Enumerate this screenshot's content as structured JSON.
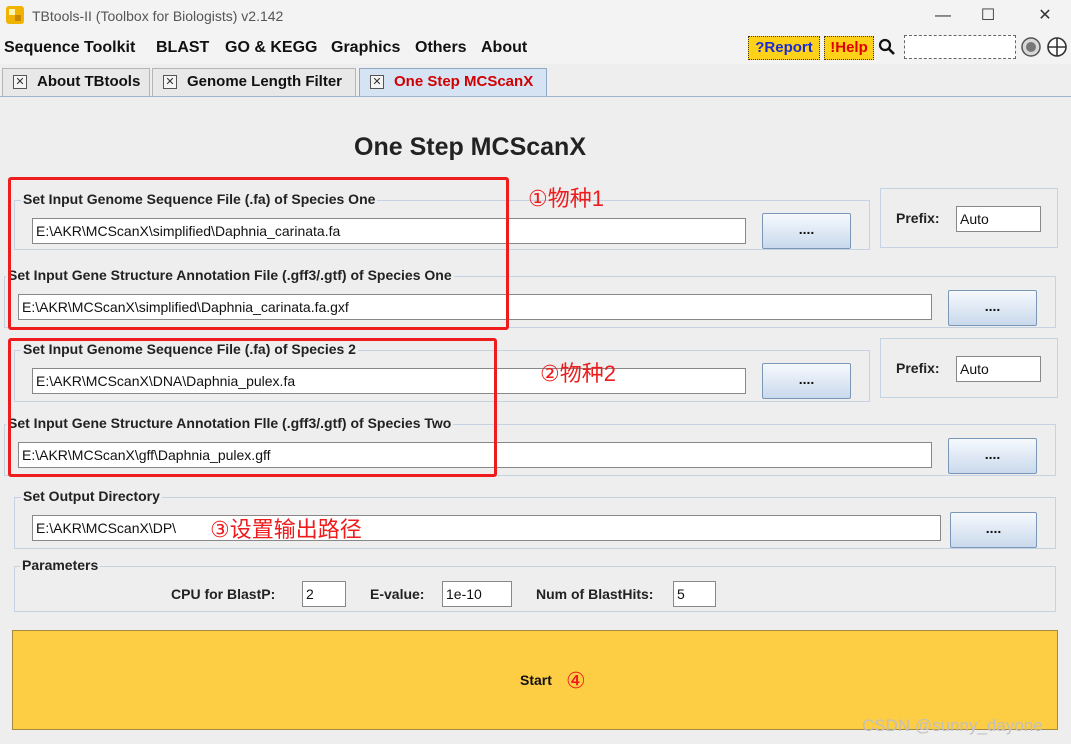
{
  "window": {
    "title": "TBtools-II (Toolbox for Biologists) v2.142",
    "minimize": "—",
    "maximize": "☐",
    "close": "✕"
  },
  "menu": {
    "items": [
      "Sequence Toolkit",
      "BLAST",
      "GO & KEGG",
      "Graphics",
      "Others",
      "About"
    ],
    "report": "?Report",
    "help": "!Help"
  },
  "tabs": [
    {
      "label": "About TBtools"
    },
    {
      "label": "Genome Length Filter"
    },
    {
      "label": "One Step MCScanX"
    }
  ],
  "page_title": "One Step MCScanX",
  "species_one": {
    "genome_label": "Set Input Genome Sequence File (.fa) of Species One",
    "genome_value": "E:\\AKR\\MCScanX\\simplified\\Daphnia_carinata.fa",
    "annotation_label": "Set Input Gene Structure Annotation File (.gff3/.gtf) of Species One",
    "annotation_value": "E:\\AKR\\MCScanX\\simplified\\Daphnia_carinata.fa.gxf",
    "prefix_label": "Prefix:",
    "prefix_value": "Auto"
  },
  "species_two": {
    "genome_label": "Set Input Genome Sequence File (.fa) of Species 2",
    "genome_value": "E:\\AKR\\MCScanX\\DNA\\Daphnia_pulex.fa",
    "annotation_label": "Set Input Gene Structure Annotation Flle (.gff3/.gtf) of Species Two",
    "annotation_value": "E:\\AKR\\MCScanX\\gff\\Daphnia_pulex.gff",
    "prefix_label": "Prefix:",
    "prefix_value": "Auto"
  },
  "output": {
    "label": "Set Output Directory",
    "value": "E:\\AKR\\MCScanX\\DP\\"
  },
  "browse_label": "....",
  "parameters": {
    "label": "Parameters",
    "cpu_label": "CPU for BlastP:",
    "cpu_value": "2",
    "evalue_label": "E-value:",
    "evalue_value": "1e-10",
    "hits_label": "Num of BlastHits:",
    "hits_value": "5"
  },
  "start_label": "Start",
  "annotations": {
    "a1": "①物种1",
    "a2": "②物种2",
    "a3": "③设置输出路径",
    "a4": "④"
  },
  "watermark": "CSDN @sunny_dayone",
  "colors": {
    "start_bg": "#fdcd44",
    "annotation_red": "#ee1c1c",
    "active_tab_text": "#d00000",
    "report_text": "#1a2bd6"
  }
}
